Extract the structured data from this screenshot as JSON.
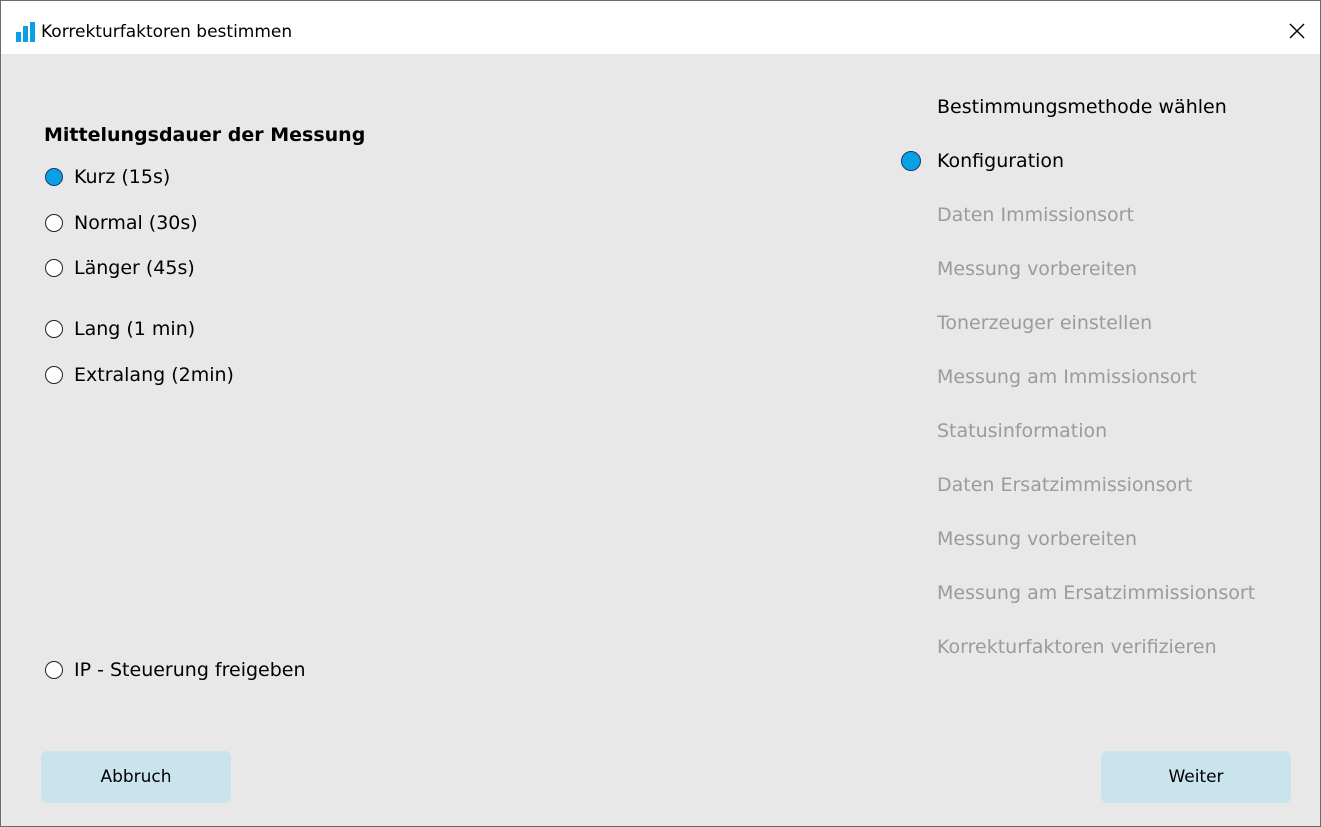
{
  "window": {
    "title": "Korrekturfaktoren bestimmen"
  },
  "duration": {
    "title": "Mittelungsdauer der Messung",
    "options": [
      {
        "label": "Kurz (15s)",
        "checked": true
      },
      {
        "label": "Normal (30s)",
        "checked": false
      },
      {
        "label": "Länger (45s)",
        "checked": false
      },
      {
        "label": "Lang (1 min)",
        "checked": false
      },
      {
        "label": "Extralang (2min)",
        "checked": false
      }
    ]
  },
  "ip_control": {
    "label": "IP - Steuerung freigeben",
    "checked": false
  },
  "steps": {
    "header": "Bestimmungsmethode wählen",
    "items": [
      {
        "label": "Konfiguration",
        "active": true
      },
      {
        "label": "Daten Immissionsort",
        "active": false
      },
      {
        "label": "Messung vorbereiten",
        "active": false
      },
      {
        "label": "Tonerzeuger einstellen",
        "active": false
      },
      {
        "label": "Messung am Immissionsort",
        "active": false
      },
      {
        "label": "Statusinformation",
        "active": false
      },
      {
        "label": "Daten Ersatzimmissionsort",
        "active": false
      },
      {
        "label": "Messung vorbereiten",
        "active": false
      },
      {
        "label": "Messung am Ersatzimmissionsort",
        "active": false
      },
      {
        "label": "Korrekturfaktoren verifizieren",
        "active": false
      }
    ]
  },
  "buttons": {
    "cancel": "Abbruch",
    "next": "Weiter"
  },
  "colors": {
    "accent": "#0aa0e6",
    "button": "#c9e4ec",
    "inactive_text": "#9b9b9b"
  },
  "icons": {
    "app": "bar-chart-icon",
    "close": "close-icon"
  }
}
